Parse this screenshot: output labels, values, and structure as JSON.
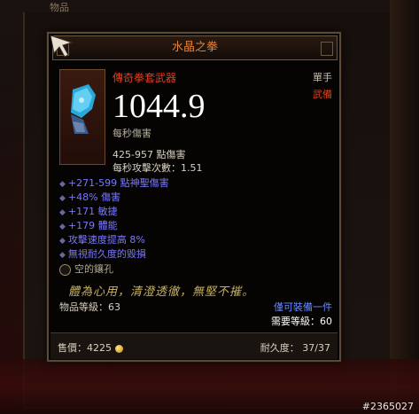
{
  "background": {
    "tab_label": "物品",
    "watermark": "#2365027"
  },
  "tooltip": {
    "title": "水晶之拳",
    "item_type": "傳奇拳套武器",
    "slot": "單手",
    "slot_type": "武備",
    "dps_value": "1044.9",
    "dps_label": "每秒傷害",
    "damage_range": "425-957 點傷害",
    "attacks_per_second": "每秒攻擊次數：1.51",
    "affixes": [
      "+271-599 點神聖傷害",
      "+48% 傷害",
      "+171 敏捷",
      "+179 體能",
      "攻擊速度提高 8%",
      "無視耐久度的毀損"
    ],
    "socket": "空的鑲孔",
    "flavor_text": "體為心用，清澄透徹，無堅不摧。",
    "item_level": "物品等級：63",
    "unique_equipped": "僅可裝備一件",
    "required_level": "需要等級：60",
    "sell_value": "售價：4225",
    "durability": "耐久度： 37/37"
  },
  "colors": {
    "title": "#e0823a",
    "legendary": "#e04020",
    "magic_affix": "#7878ff",
    "flavor": "#c8b060"
  },
  "icons": [
    "cursor-arrow-icon",
    "gem-fist-weapon-icon",
    "socket-icon",
    "gold-coin-icon"
  ]
}
